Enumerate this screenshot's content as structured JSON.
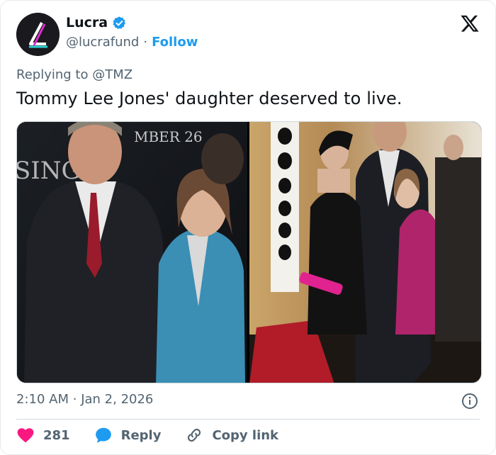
{
  "author": {
    "name": "Lucra",
    "handle": "@lucrafund",
    "separator": "·",
    "follow_label": "Follow"
  },
  "reply": {
    "prefix": "Replying to",
    "target": "@TMZ"
  },
  "tweet": {
    "text": "Tommy Lee Jones' daughter deserved to live."
  },
  "media": {
    "left_photo": {
      "backdrop_text_top": "MBER 26",
      "backdrop_text_left": "SING"
    },
    "right_photo": {}
  },
  "meta": {
    "time": "2:10 AM",
    "separator": "·",
    "date": "Jan 2, 2026"
  },
  "actions": {
    "like_count": "281",
    "reply_label": "Reply",
    "copy_label": "Copy link"
  },
  "icons": {
    "verified": "verified-badge-icon",
    "logo": "x-logo-icon",
    "info": "info-icon",
    "heart": "heart-icon",
    "reply": "reply-bubble-icon",
    "link": "link-icon"
  },
  "colors": {
    "accent": "#1d9bf0",
    "heart": "#f91880",
    "muted": "#536471",
    "text": "#0f1419"
  }
}
